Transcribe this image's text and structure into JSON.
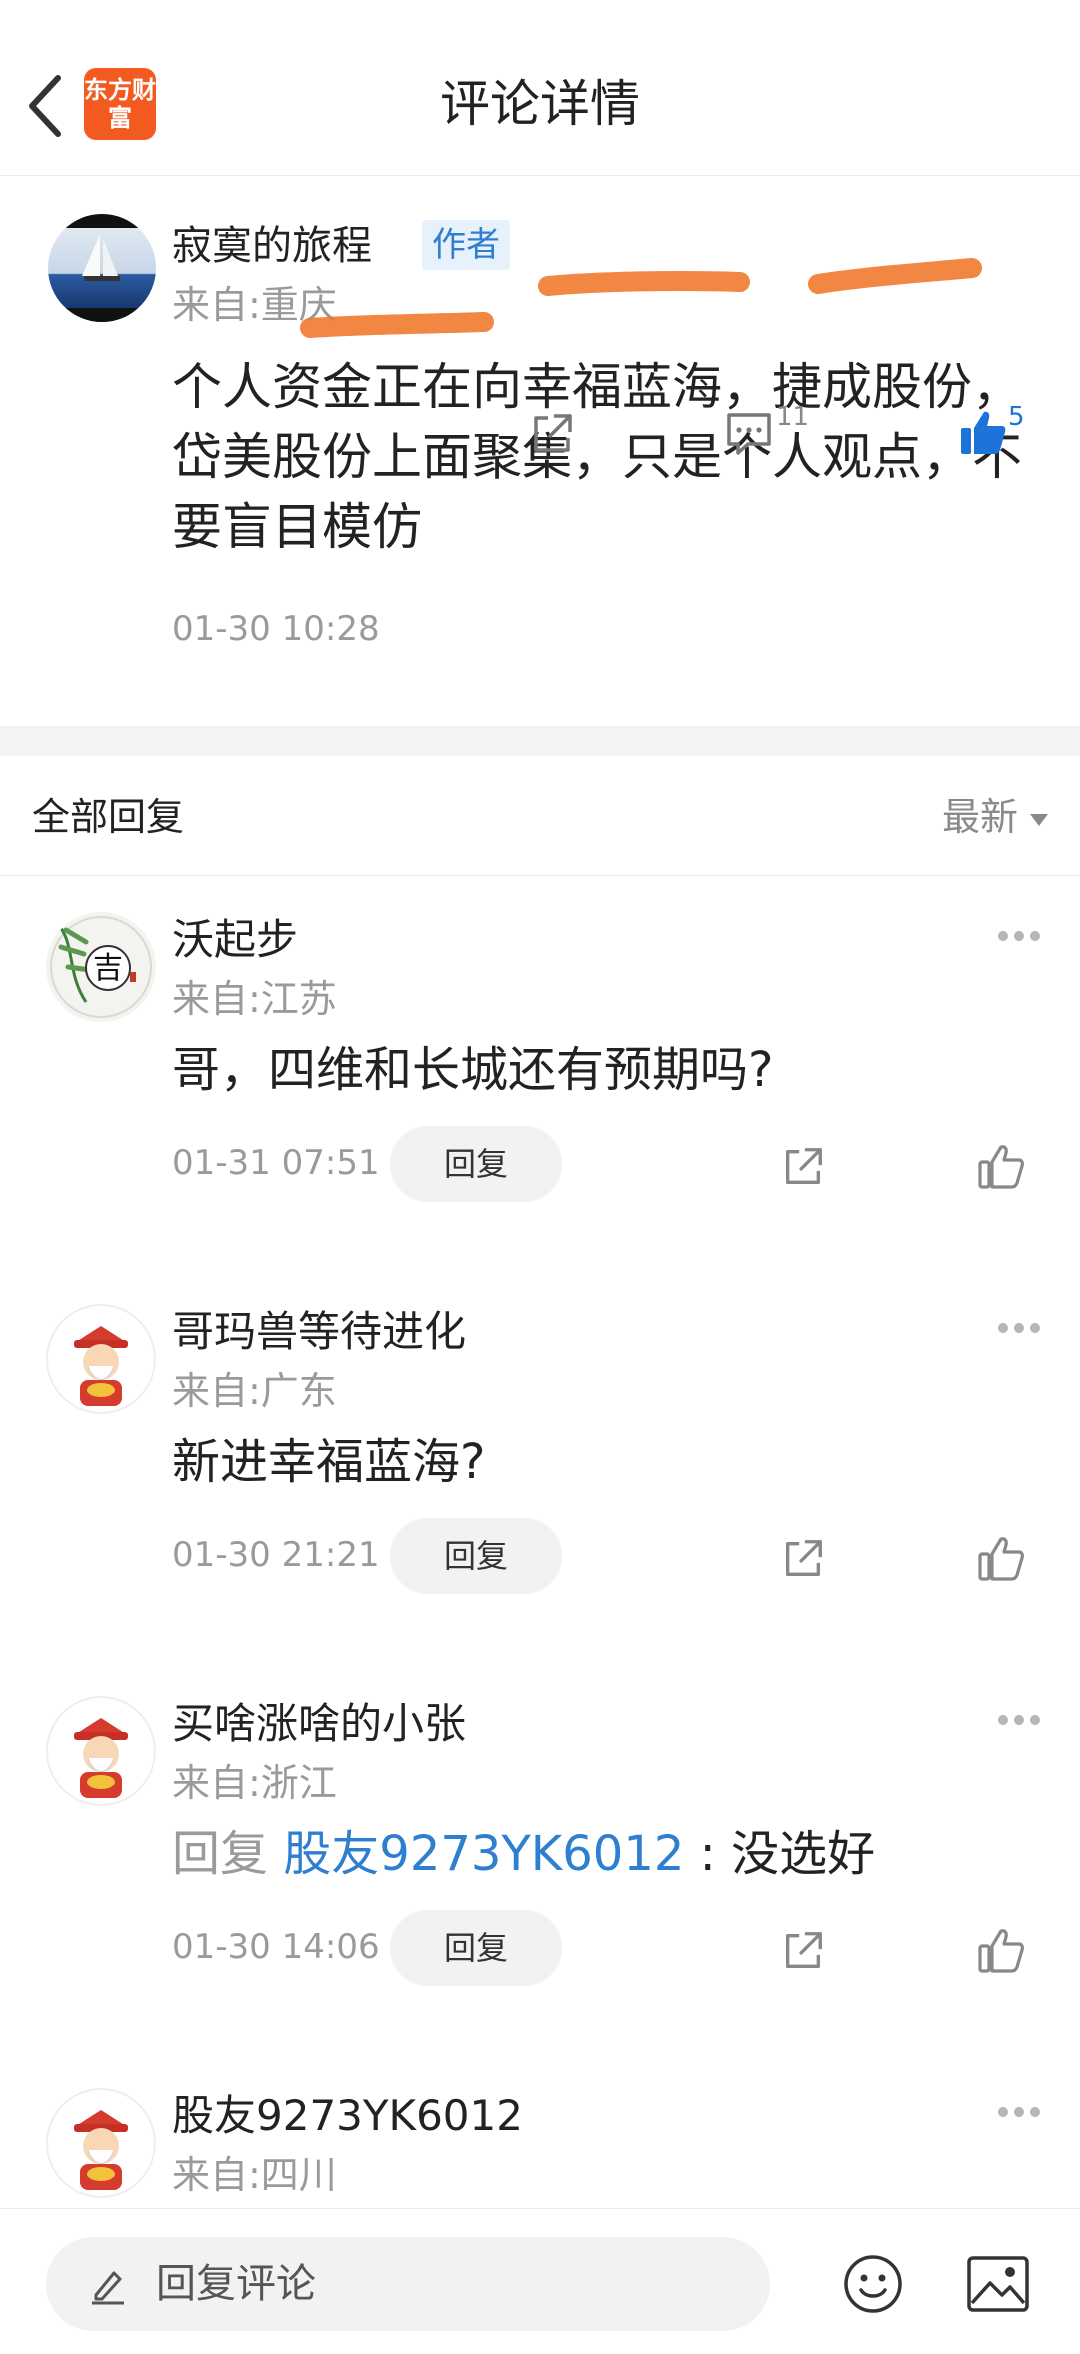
{
  "header": {
    "title": "评论详情",
    "logo_text": "东方财富",
    "brand_color": "#f25a1f"
  },
  "post": {
    "user": "寂寞的旅程",
    "badge": "作者",
    "location": "来自:重庆",
    "content": "个人资金正在向幸福蓝海，捷成股份，岱美股份上面聚集，只是个人观点，不要盲目模仿",
    "time": "01-30 10:28",
    "comment_count": "11",
    "like_count": "5"
  },
  "replies": {
    "title": "全部回复",
    "sort_label": "最新"
  },
  "comments": [
    {
      "user": "沃起步",
      "location": "来自:江苏",
      "text": "哥，四维和长城还有预期吗?",
      "time": "01-31 07:51",
      "reply_label": "回复"
    },
    {
      "user": "哥玛兽等待进化",
      "location": "来自:广东",
      "text": "新进幸福蓝海?",
      "time": "01-30 21:21",
      "reply_label": "回复"
    },
    {
      "user": "买啥涨啥的小张",
      "location": "来自:浙江",
      "reply_prefix": "回复",
      "reply_to": "股友9273YK6012",
      "text": ": 没选好",
      "time": "01-30 14:06",
      "reply_label": "回复"
    },
    {
      "user": "股友9273YK6012",
      "location": "来自:四川"
    }
  ],
  "bottom": {
    "reply_placeholder": "回复评论"
  }
}
